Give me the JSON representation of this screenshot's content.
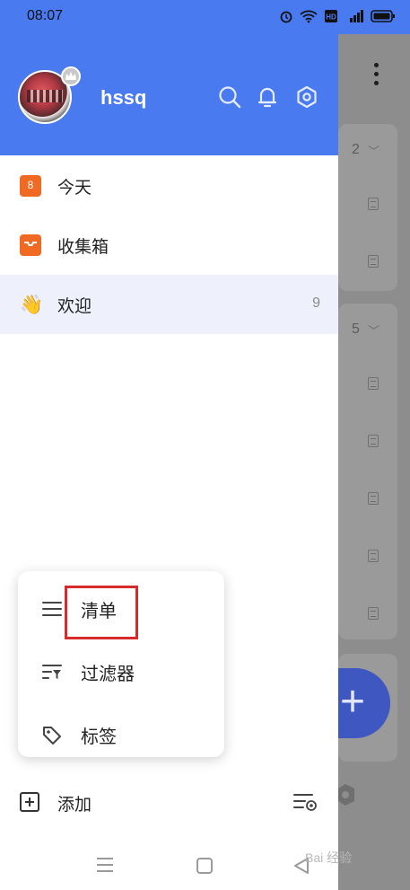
{
  "status_bar": {
    "time": "08:07",
    "icons": [
      "alarm-icon",
      "wifi-icon",
      "hd-icon",
      "signal-4g-icon",
      "battery-icon"
    ]
  },
  "header": {
    "username": "hssq",
    "icons": [
      "search-icon",
      "bell-icon",
      "settings-icon"
    ],
    "accent_color": "#4a7af0"
  },
  "nav": {
    "items": [
      {
        "label": "今天",
        "icon": "calendar-icon",
        "date_badge": "8",
        "count": ""
      },
      {
        "label": "收集箱",
        "icon": "inbox-icon",
        "count": ""
      },
      {
        "label": "欢迎",
        "icon": "waving-hand-icon",
        "emoji": "👋",
        "count": "9",
        "selected": true
      }
    ]
  },
  "popup_menu": {
    "items": [
      {
        "label": "清单",
        "icon": "list-icon",
        "highlighted": true
      },
      {
        "label": "过滤器",
        "icon": "filter-icon"
      },
      {
        "label": "标签",
        "icon": "tag-icon"
      }
    ]
  },
  "footer": {
    "add_label": "添加",
    "manage_icon": "manage-lists-icon"
  },
  "background_page": {
    "group_counts": [
      "2",
      "5"
    ],
    "fab_label": "+"
  },
  "system_nav": {
    "watermark": "Bai 经验"
  }
}
